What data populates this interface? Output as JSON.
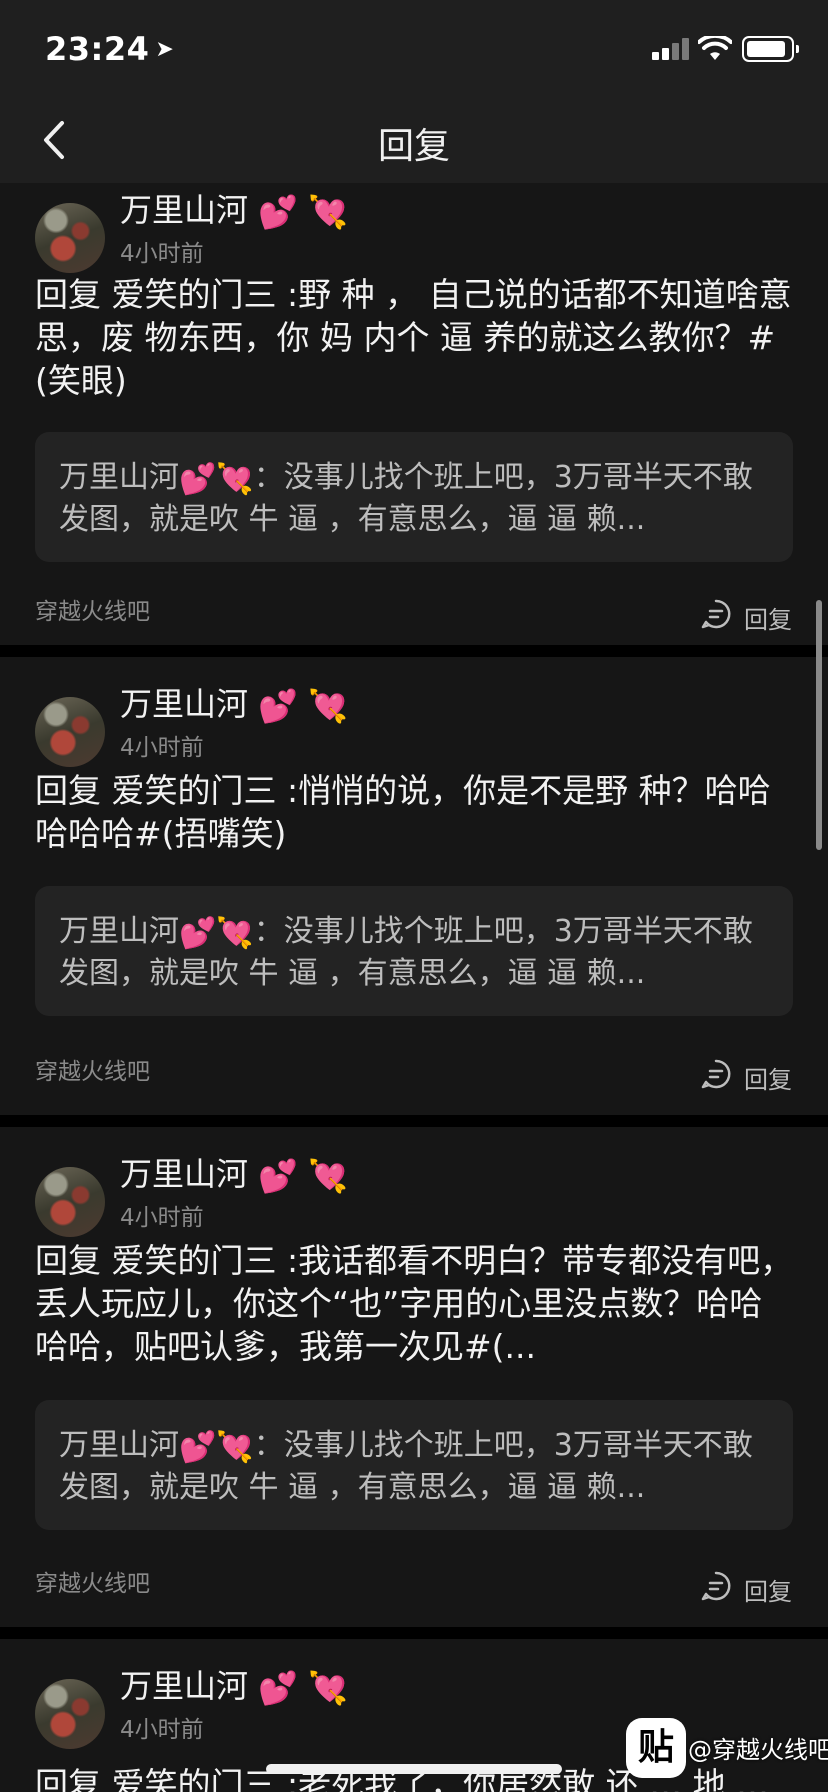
{
  "status_bar": {
    "time": "23:24",
    "location_arrow": "location-arrow-icon"
  },
  "nav": {
    "title": "回复",
    "back_icon": "back-chevron-icon"
  },
  "posts": [
    {
      "username": "万里山河",
      "time": "4小时前",
      "body": "回复 爱笑的门三 :野 种 ， 自己说的话都不知道啥意思，废 物东西，你 妈 内个 逼 养的就这么教你？#(笑眼)",
      "quote_author": "万里山河",
      "quote_text": "：没事儿找个班上吧，3万哥半天不敢发图，就是吹 牛 逼 ，有意思么，逼 逼 赖...",
      "forum": "穿越火线吧",
      "reply_label": "回复"
    },
    {
      "username": "万里山河",
      "time": "4小时前",
      "body": "回复 爱笑的门三 :悄悄的说，你是不是野 种？哈哈哈哈哈#(捂嘴笑)",
      "quote_author": "万里山河",
      "quote_text": "：没事儿找个班上吧，3万哥半天不敢发图，就是吹 牛 逼 ，有意思么，逼 逼 赖...",
      "forum": "穿越火线吧",
      "reply_label": "回复"
    },
    {
      "username": "万里山河",
      "time": "4小时前",
      "body": "回复 爱笑的门三 :我话都看不明白？带专都没有吧，丢人玩应儿，你这个“也”字用的心里没点数？哈哈哈哈，贴吧认爹，我第一次见#(...",
      "quote_author": "万里山河",
      "quote_text": "：没事儿找个班上吧，3万哥半天不敢发图，就是吹 牛 逼 ，有意思么，逼 逼 赖...",
      "forum": "穿越火线吧",
      "reply_label": "回复"
    },
    {
      "username": "万里山河",
      "time": "4小时前",
      "body": "回复 爱笑的门三 :老死我了，你居然敢 还 … 地 …",
      "forum": "",
      "reply_label": ""
    }
  ],
  "watermark": {
    "logo": "贴",
    "text": "@穿越火线吧"
  },
  "colors": {
    "background": "#000000",
    "card": "#161616",
    "quote": "#232323",
    "secondary_text": "#8a8a8a"
  }
}
